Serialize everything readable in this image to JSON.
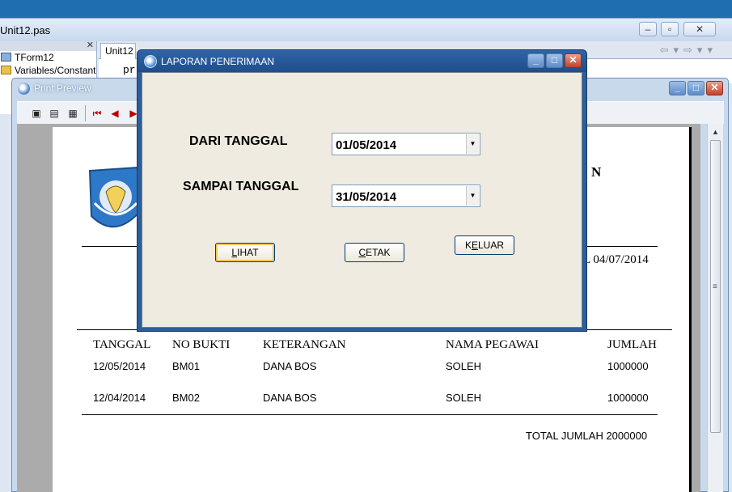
{
  "ide": {
    "title": "Unit12.pas",
    "tree": [
      "TForm12",
      "Variables/Constants"
    ],
    "tab": "Unit12",
    "code_fragment": "pr"
  },
  "preview": {
    "title": "Print Preview",
    "report": {
      "header_fragment": "N",
      "date_fragment": "L 04/07/2014",
      "columns": [
        "TANGGAL",
        "NO BUKTI",
        "KETERANGAN",
        "NAMA PEGAWAI",
        "JUMLAH"
      ],
      "rows": [
        [
          "12/05/2014",
          "BM01",
          "DANA BOS",
          "SOLEH",
          "1000000"
        ],
        [
          "12/04/2014",
          "BM02",
          "DANA BOS",
          "SOLEH",
          "1000000"
        ]
      ],
      "total": "TOTAL JUMLAH 2000000"
    }
  },
  "dialog": {
    "title": "LAPORAN PENERIMAAN",
    "from_label": "DARI TANGGAL",
    "from_value": "01/05/2014",
    "to_label": "SAMPAI TANGGAL",
    "to_value": "31/05/2014",
    "buttons": {
      "view": {
        "text": "LIHAT",
        "accel": "L",
        "rest": "IHAT"
      },
      "print": {
        "text": "CETAK",
        "accel": "C",
        "rest": "ETAK"
      },
      "exit": {
        "text": "KELUAR",
        "pre": "K",
        "accel": "E",
        "rest": "LUAR"
      }
    }
  }
}
